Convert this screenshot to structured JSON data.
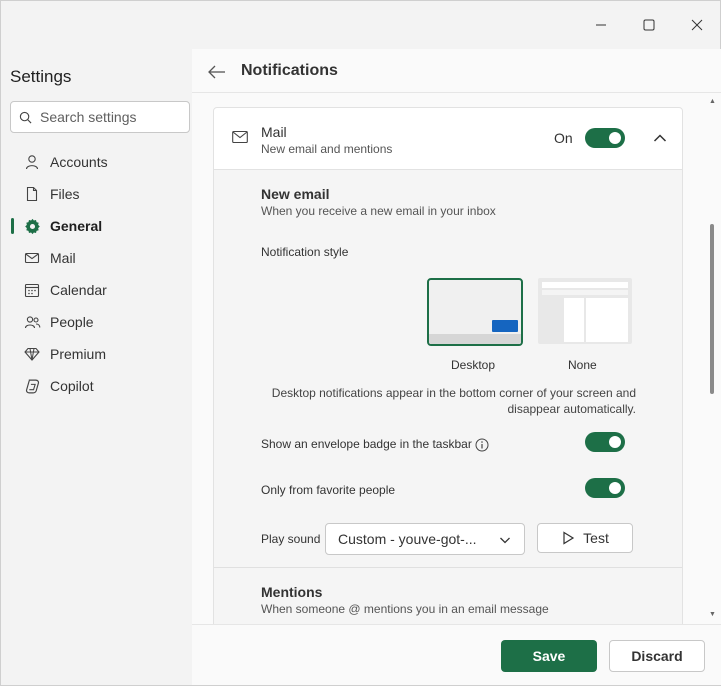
{
  "sidebar": {
    "title": "Settings",
    "search_placeholder": "Search settings",
    "items": [
      {
        "label": "Accounts",
        "icon": "person-icon"
      },
      {
        "label": "Files",
        "icon": "file-icon"
      },
      {
        "label": "General",
        "icon": "gear-icon",
        "active": true
      },
      {
        "label": "Mail",
        "icon": "mail-icon"
      },
      {
        "label": "Calendar",
        "icon": "calendar-icon"
      },
      {
        "label": "People",
        "icon": "people-icon"
      },
      {
        "label": "Premium",
        "icon": "diamond-icon"
      },
      {
        "label": "Copilot",
        "icon": "copilot-icon"
      }
    ]
  },
  "header": {
    "title": "Notifications"
  },
  "mail_card": {
    "title": "Mail",
    "subtitle": "New email and mentions",
    "state_label": "On",
    "enabled": true
  },
  "new_email": {
    "title": "New email",
    "subtitle": "When you receive a new email in your inbox",
    "style_label": "Notification style",
    "options": [
      {
        "label": "Desktop",
        "selected": true
      },
      {
        "label": "None",
        "selected": false
      }
    ],
    "description": "Desktop notifications appear in the bottom corner of your screen and disappear automatically.",
    "badge_label": "Show an envelope badge in the taskbar",
    "badge_enabled": true,
    "favorites_label": "Only from favorite people",
    "favorites_enabled": true,
    "sound_label": "Play sound",
    "sound_value": "Custom - youve-got-...",
    "test_label": "Test"
  },
  "mentions": {
    "title": "Mentions",
    "subtitle": "When someone @ mentions you in an email message"
  },
  "footer": {
    "save_label": "Save",
    "discard_label": "Discard"
  },
  "colors": {
    "accent": "#1d6f47",
    "toast": "#1565c0"
  }
}
